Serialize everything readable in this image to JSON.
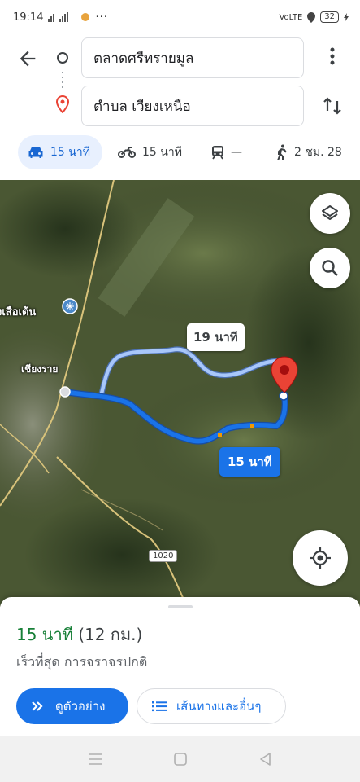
{
  "status_bar": {
    "time": "19:14",
    "network": "VoLTE",
    "battery": "32"
  },
  "search": {
    "origin": "ตลาดศรีทรายมูล",
    "destination": "ตำบล เวียงเหนือ"
  },
  "modes": [
    {
      "icon": "car-icon",
      "label": "15 นาที"
    },
    {
      "icon": "motorcycle-icon",
      "label": "15 นาที"
    },
    {
      "icon": "transit-icon",
      "label": "—"
    },
    {
      "icon": "walk-icon",
      "label": "2 ชม. 28"
    }
  ],
  "map": {
    "alt_route_label": "19 นาที",
    "main_route_label": "15 นาที",
    "places": [
      "งเสือเต้น",
      "เชียงราย"
    ],
    "road_number": "1020",
    "colors": {
      "route": "#1a73e8",
      "alt_route": "#a8c7fa",
      "pin": "#ea4335"
    }
  },
  "summary": {
    "time": "15 นาที",
    "distance": "(12 กม.)",
    "description": "เร็วที่สุด การจราจรปกติ",
    "preview_label": "ดูตัวอย่าง",
    "steps_label": "เส้นทางและอื่นๆ"
  }
}
